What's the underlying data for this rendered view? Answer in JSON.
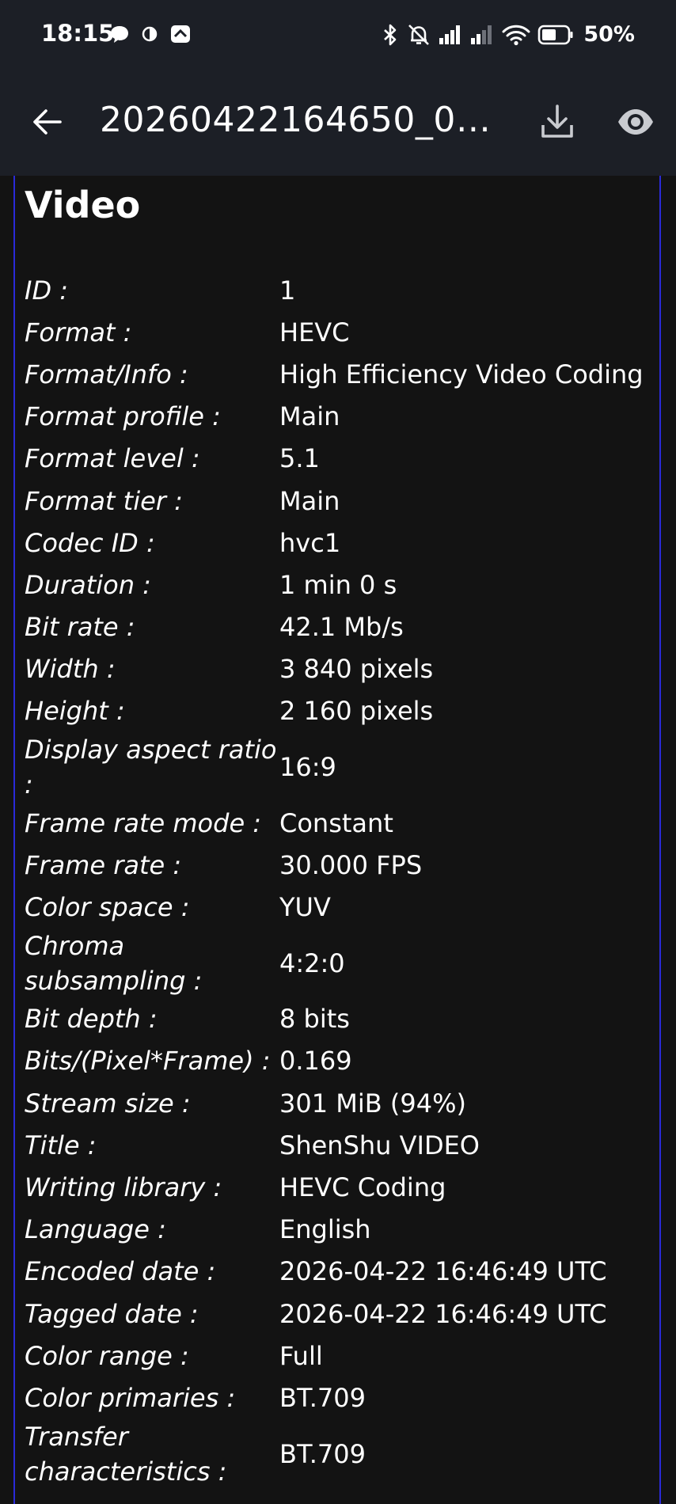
{
  "status_bar": {
    "time": "18:15",
    "battery": "50%"
  },
  "app_bar": {
    "title": "20260422164650_00..."
  },
  "section": {
    "title": "Video"
  },
  "rows": [
    {
      "label": "ID :",
      "value": "1"
    },
    {
      "label": "Format :",
      "value": "HEVC"
    },
    {
      "label": "Format/Info :",
      "value": "High Efficiency Video Coding"
    },
    {
      "label": "Format profile :",
      "value": "Main"
    },
    {
      "label": "Format level :",
      "value": "5.1"
    },
    {
      "label": "Format tier :",
      "value": "Main"
    },
    {
      "label": "Codec ID :",
      "value": "hvc1"
    },
    {
      "label": "Duration :",
      "value": "1 min 0 s"
    },
    {
      "label": "Bit rate :",
      "value": "42.1 Mb/s"
    },
    {
      "label": "Width :",
      "value": "3 840 pixels"
    },
    {
      "label": "Height :",
      "value": "2 160 pixels"
    },
    {
      "label": "Display aspect ratio :",
      "value": "16:9"
    },
    {
      "label": "Frame rate mode :",
      "value": "Constant"
    },
    {
      "label": "Frame rate :",
      "value": "30.000 FPS"
    },
    {
      "label": "Color space :",
      "value": "YUV"
    },
    {
      "label": "Chroma subsampling :",
      "value": "4:2:0"
    },
    {
      "label": "Bit depth :",
      "value": "8 bits"
    },
    {
      "label": "Bits/(Pixel*Frame) :",
      "value": "0.169"
    },
    {
      "label": "Stream size :",
      "value": "301 MiB (94%)"
    },
    {
      "label": "Title :",
      "value": "ShenShu VIDEO"
    },
    {
      "label": "Writing library :",
      "value": "HEVC Coding"
    },
    {
      "label": "Language :",
      "value": "English"
    },
    {
      "label": "Encoded date :",
      "value": "2026-04-22 16:46:49 UTC"
    },
    {
      "label": "Tagged date :",
      "value": "2026-04-22 16:46:49 UTC"
    },
    {
      "label": "Color range :",
      "value": "Full"
    },
    {
      "label": "Color primaries :",
      "value": "BT.709"
    },
    {
      "label": "Transfer characteristics :",
      "value": "BT.709"
    }
  ],
  "icons": {
    "back": "arrow-back-icon",
    "download": "download-icon",
    "view": "eye-icon"
  },
  "colors": {
    "app_bar": "#1c1f26",
    "background": "#131313",
    "accent_border": "#2a2ad8"
  }
}
